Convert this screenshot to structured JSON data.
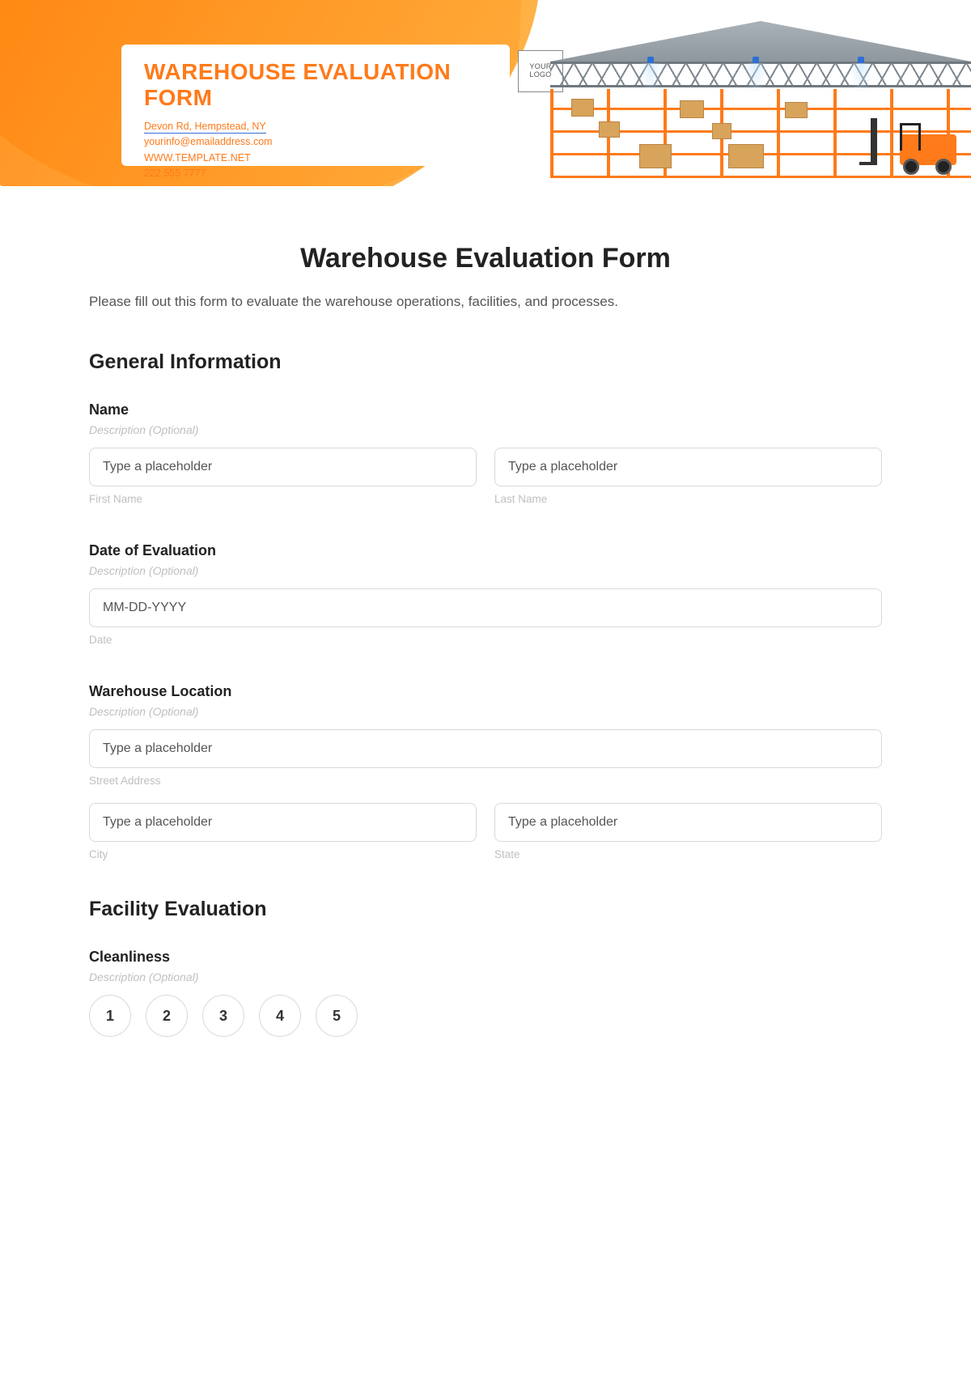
{
  "banner": {
    "title": "WAREHOUSE EVALUATION FORM",
    "address": "Devon Rd, Hempstead, NY",
    "email": "yourinfo@emailaddress.com",
    "website": "WWW.TEMPLATE.NET",
    "phone": "222 555 7777",
    "logo_text": "YOUR\nLOGO"
  },
  "form": {
    "title": "Warehouse Evaluation Form",
    "intro": "Please fill out this form to evaluate the warehouse operations, facilities, and processes."
  },
  "sections": {
    "general": "General Information",
    "facility": "Facility Evaluation"
  },
  "fields": {
    "name": {
      "label": "Name",
      "desc": "Description (Optional)",
      "first_placeholder": "Type a placeholder",
      "first_sub": "First Name",
      "last_placeholder": "Type a placeholder",
      "last_sub": "Last Name"
    },
    "date": {
      "label": "Date of Evaluation",
      "desc": "Description (Optional)",
      "placeholder": "MM-DD-YYYY",
      "sub": "Date"
    },
    "location": {
      "label": "Warehouse Location",
      "desc": "Description (Optional)",
      "street_placeholder": "Type a placeholder",
      "street_sub": "Street Address",
      "city_placeholder": "Type a placeholder",
      "city_sub": "City",
      "state_placeholder": "Type a placeholder",
      "state_sub": "State"
    },
    "cleanliness": {
      "label": "Cleanliness",
      "desc": "Description (Optional)",
      "options": [
        "1",
        "2",
        "3",
        "4",
        "5"
      ]
    }
  }
}
